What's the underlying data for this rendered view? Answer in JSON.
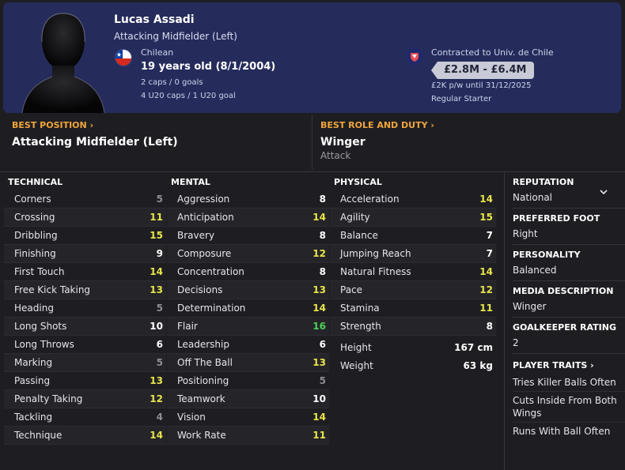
{
  "player": {
    "name": "Lucas Assadi",
    "position": "Attacking Midfielder (Left)",
    "nationality": "Chilean",
    "age_dob": "19 years old (8/1/2004)",
    "caps": "2 caps / 0 goals",
    "u20_caps": "4 U20 caps / 1 U20 goal"
  },
  "contract": {
    "club_line": "Contracted to Univ. de Chile",
    "value": "£2.8M - £6.4M",
    "wage": "£2K p/w until 31/12/2025",
    "status": "Regular Starter"
  },
  "best_position": {
    "label": "BEST POSITION",
    "value": "Attacking Midfielder (Left)"
  },
  "best_role": {
    "label": "BEST ROLE AND DUTY",
    "role": "Winger",
    "duty": "Attack"
  },
  "technical": {
    "title": "TECHNICAL",
    "rows": [
      {
        "name": "Corners",
        "value": "5"
      },
      {
        "name": "Crossing",
        "value": "11"
      },
      {
        "name": "Dribbling",
        "value": "15"
      },
      {
        "name": "Finishing",
        "value": "9"
      },
      {
        "name": "First Touch",
        "value": "14"
      },
      {
        "name": "Free Kick Taking",
        "value": "13"
      },
      {
        "name": "Heading",
        "value": "5"
      },
      {
        "name": "Long Shots",
        "value": "10"
      },
      {
        "name": "Long Throws",
        "value": "6"
      },
      {
        "name": "Marking",
        "value": "5"
      },
      {
        "name": "Passing",
        "value": "13"
      },
      {
        "name": "Penalty Taking",
        "value": "12"
      },
      {
        "name": "Tackling",
        "value": "4"
      },
      {
        "name": "Technique",
        "value": "14"
      }
    ]
  },
  "mental": {
    "title": "MENTAL",
    "rows": [
      {
        "name": "Aggression",
        "value": "8"
      },
      {
        "name": "Anticipation",
        "value": "14"
      },
      {
        "name": "Bravery",
        "value": "8"
      },
      {
        "name": "Composure",
        "value": "12"
      },
      {
        "name": "Concentration",
        "value": "8"
      },
      {
        "name": "Decisions",
        "value": "13"
      },
      {
        "name": "Determination",
        "value": "14"
      },
      {
        "name": "Flair",
        "value": "16"
      },
      {
        "name": "Leadership",
        "value": "6"
      },
      {
        "name": "Off The Ball",
        "value": "13"
      },
      {
        "name": "Positioning",
        "value": "5"
      },
      {
        "name": "Teamwork",
        "value": "10"
      },
      {
        "name": "Vision",
        "value": "14"
      },
      {
        "name": "Work Rate",
        "value": "11"
      }
    ]
  },
  "physical": {
    "title": "PHYSICAL",
    "rows": [
      {
        "name": "Acceleration",
        "value": "14"
      },
      {
        "name": "Agility",
        "value": "15"
      },
      {
        "name": "Balance",
        "value": "7"
      },
      {
        "name": "Jumping Reach",
        "value": "7"
      },
      {
        "name": "Natural Fitness",
        "value": "14"
      },
      {
        "name": "Pace",
        "value": "12"
      },
      {
        "name": "Stamina",
        "value": "11"
      },
      {
        "name": "Strength",
        "value": "8"
      }
    ],
    "height_label": "Height",
    "height": "167 cm",
    "weight_label": "Weight",
    "weight": "63 kg"
  },
  "info": {
    "reputation_label": "REPUTATION",
    "reputation": "National",
    "foot_label": "PREFERRED FOOT",
    "foot": "Right",
    "personality_label": "PERSONALITY",
    "personality": "Balanced",
    "media_label": "MEDIA DESCRIPTION",
    "media": "Winger",
    "gk_label": "GOALKEEPER RATING",
    "gk": "2",
    "traits_label": "PLAYER TRAITS",
    "traits": [
      "Tries Killer Balls Often",
      "Cuts Inside From Both Wings",
      "Runs With Ball Often"
    ]
  },
  "colors": {
    "header_bg": "#252c5c",
    "accent_orange": "#f0a53a",
    "rating_yellow": "#e8e54a",
    "rating_green": "#4cd05a",
    "rating_grey": "#8d8d95"
  },
  "icons": [
    "player-silhouette-icon",
    "chile-flag-icon",
    "club-badge-icon",
    "chevron-right-icon",
    "chevron-down-icon"
  ]
}
